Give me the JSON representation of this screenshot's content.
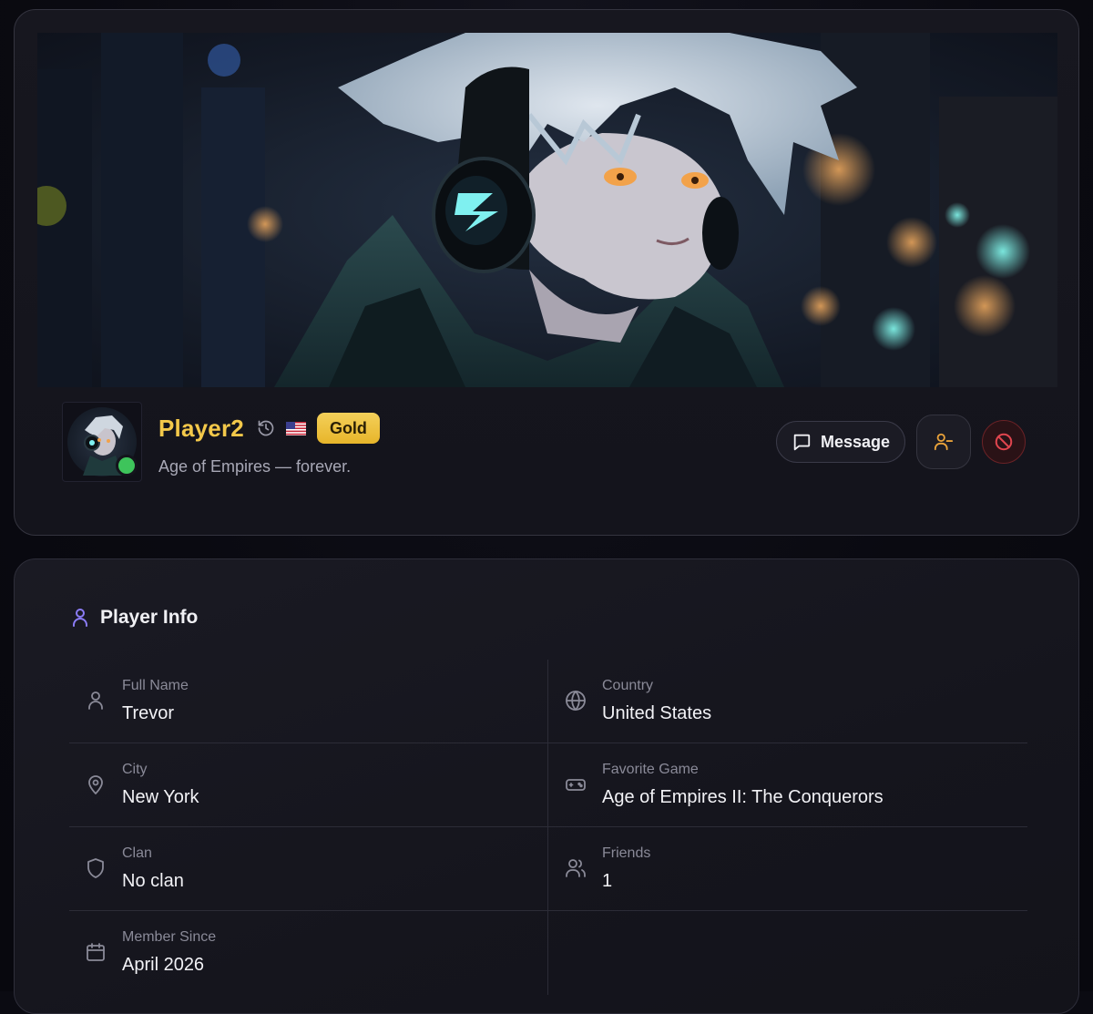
{
  "profile": {
    "player_name": "Player2",
    "rank_badge": "Gold",
    "bio": "Age of Empires — forever.",
    "country_flag": "flag-us-icon",
    "status": "online",
    "status_color": "#3ec45b",
    "name_color": "#f3c84a"
  },
  "actions": {
    "message_label": "Message",
    "add_friend_icon": "user-minus-icon",
    "block_icon": "block-icon"
  },
  "player_info": {
    "title": "Player Info",
    "fields": [
      {
        "label": "Full Name",
        "value": "Trevor",
        "icon": "user-icon"
      },
      {
        "label": "Country",
        "value": "United States",
        "icon": "globe-icon"
      },
      {
        "label": "City",
        "value": "New York",
        "icon": "map-pin-icon"
      },
      {
        "label": "Favorite Game",
        "value": "Age of Empires II: The Conquerors",
        "icon": "gamepad-icon"
      },
      {
        "label": "Clan",
        "value": "No clan",
        "icon": "shield-icon"
      },
      {
        "label": "Friends",
        "value": "1",
        "icon": "users-icon"
      },
      {
        "label": "Member Since",
        "value": "April 2026",
        "icon": "calendar-icon"
      }
    ]
  },
  "colors": {
    "accent_gold": "#f3c84a",
    "accent_purple": "#8b7cf6",
    "danger": "#e0454e"
  }
}
